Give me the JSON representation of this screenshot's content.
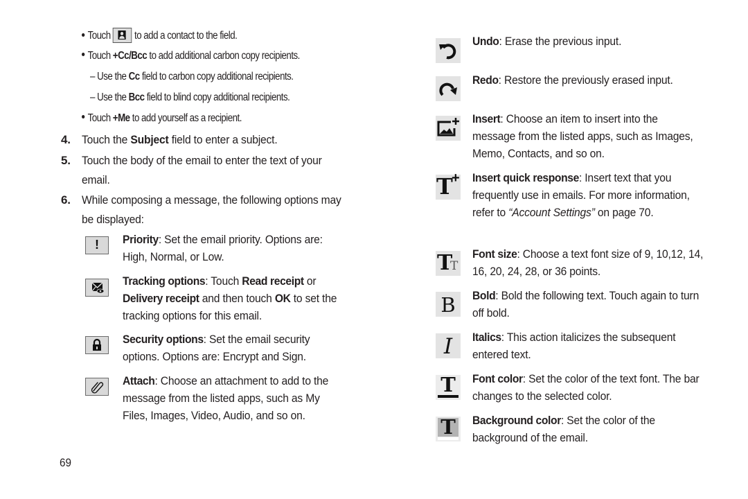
{
  "page_number": "69",
  "bullets": [
    {
      "before": "Touch",
      "icon": "contact-icon",
      "after": "to add a contact to the field."
    },
    {
      "before": "Touch",
      "bold": "+Cc/Bcc",
      "after": "to add additional carbon copy recipients."
    },
    {
      "before": "Touch",
      "bold": "+Me",
      "after": "to add yourself as a recipient."
    }
  ],
  "sub_bullets": [
    {
      "before": "Use the",
      "bold": "Cc",
      "after": "field to carbon copy additional recipients."
    },
    {
      "before": "Use the",
      "bold": "Bcc",
      "after": "field to blind copy additional recipients."
    }
  ],
  "steps": [
    {
      "num": "4.",
      "before": "Touch the",
      "bold": "Subject",
      "after": "field to enter a subject."
    },
    {
      "num": "5.",
      "text": "Touch the body of the email to enter the text of your email."
    },
    {
      "num": "6.",
      "text": "While composing a message, the following options may be displayed:"
    }
  ],
  "left_options": [
    {
      "icon": "priority-icon",
      "title": "Priority",
      "desc": ": Set the email priority. Options are: High, Normal, or Low."
    },
    {
      "icon": "tracking-icon",
      "title": "Tracking options",
      "parts": [
        {
          "t": ": Touch ",
          "b": false
        },
        {
          "t": "Read receipt",
          "b": true
        },
        {
          "t": " or ",
          "b": false
        },
        {
          "t": "Delivery receipt",
          "b": true
        },
        {
          "t": " and then touch ",
          "b": false
        },
        {
          "t": "OK",
          "b": true
        },
        {
          "t": " to set the tracking options for this email.",
          "b": false
        }
      ]
    },
    {
      "icon": "lock-icon",
      "title": "Security options",
      "desc": ": Set the email security options. Options are: Encrypt and Sign."
    },
    {
      "icon": "paperclip-icon",
      "title": "Attach",
      "desc": ": Choose an attachment to add to the message from the listed apps, such as My Files, Images, Video, Audio, and so on."
    }
  ],
  "right_options": [
    {
      "icon": "undo-icon",
      "title": "Undo",
      "desc": ": Erase the previous input."
    },
    {
      "icon": "redo-icon",
      "title": "Redo",
      "desc": ": Restore the previously erased input."
    },
    {
      "icon": "insert-image-icon",
      "title": "Insert",
      "desc": ": Choose an item to insert into the message from the listed apps, such as Images, Memo, Contacts, and so on."
    },
    {
      "icon": "quick-response-icon",
      "title": "Insert quick response",
      "desc": ": Insert text that you frequently use in emails. For more information, refer to ",
      "italic": "“Account Settings”",
      "desc_end": " on page 70."
    },
    {
      "icon": "font-size-icon",
      "title": "Font size",
      "desc": ": Choose a text font size of 9, 10,12, 14, 16, 20, 24, 28, or 36 points."
    },
    {
      "icon": "bold-icon",
      "title": "Bold",
      "desc": ": Bold the following text. Touch again to turn off bold."
    },
    {
      "icon": "italic-icon",
      "title": "Italics",
      "desc": ": This action italicizes the subsequent entered text."
    },
    {
      "icon": "font-color-icon",
      "title": "Font color",
      "desc": ": Set the color of the text font. The bar changes to the selected color."
    },
    {
      "icon": "background-color-icon",
      "title": "Background color",
      "desc": ": Set the color of the background of the email."
    }
  ],
  "icon_glyphs": {
    "priority": "!",
    "bold": "B",
    "italic": "I",
    "font_color": "T",
    "background_color": "T",
    "quick_response": "T",
    "quick_response_plus": "+",
    "font_size_big": "T",
    "font_size_small": "T"
  },
  "colors": {
    "text": "#231f20",
    "icon_bg": "#e3e3e3",
    "button_bg": "#d9d9d9",
    "bg_color_swatch": "#b3b3b3"
  }
}
